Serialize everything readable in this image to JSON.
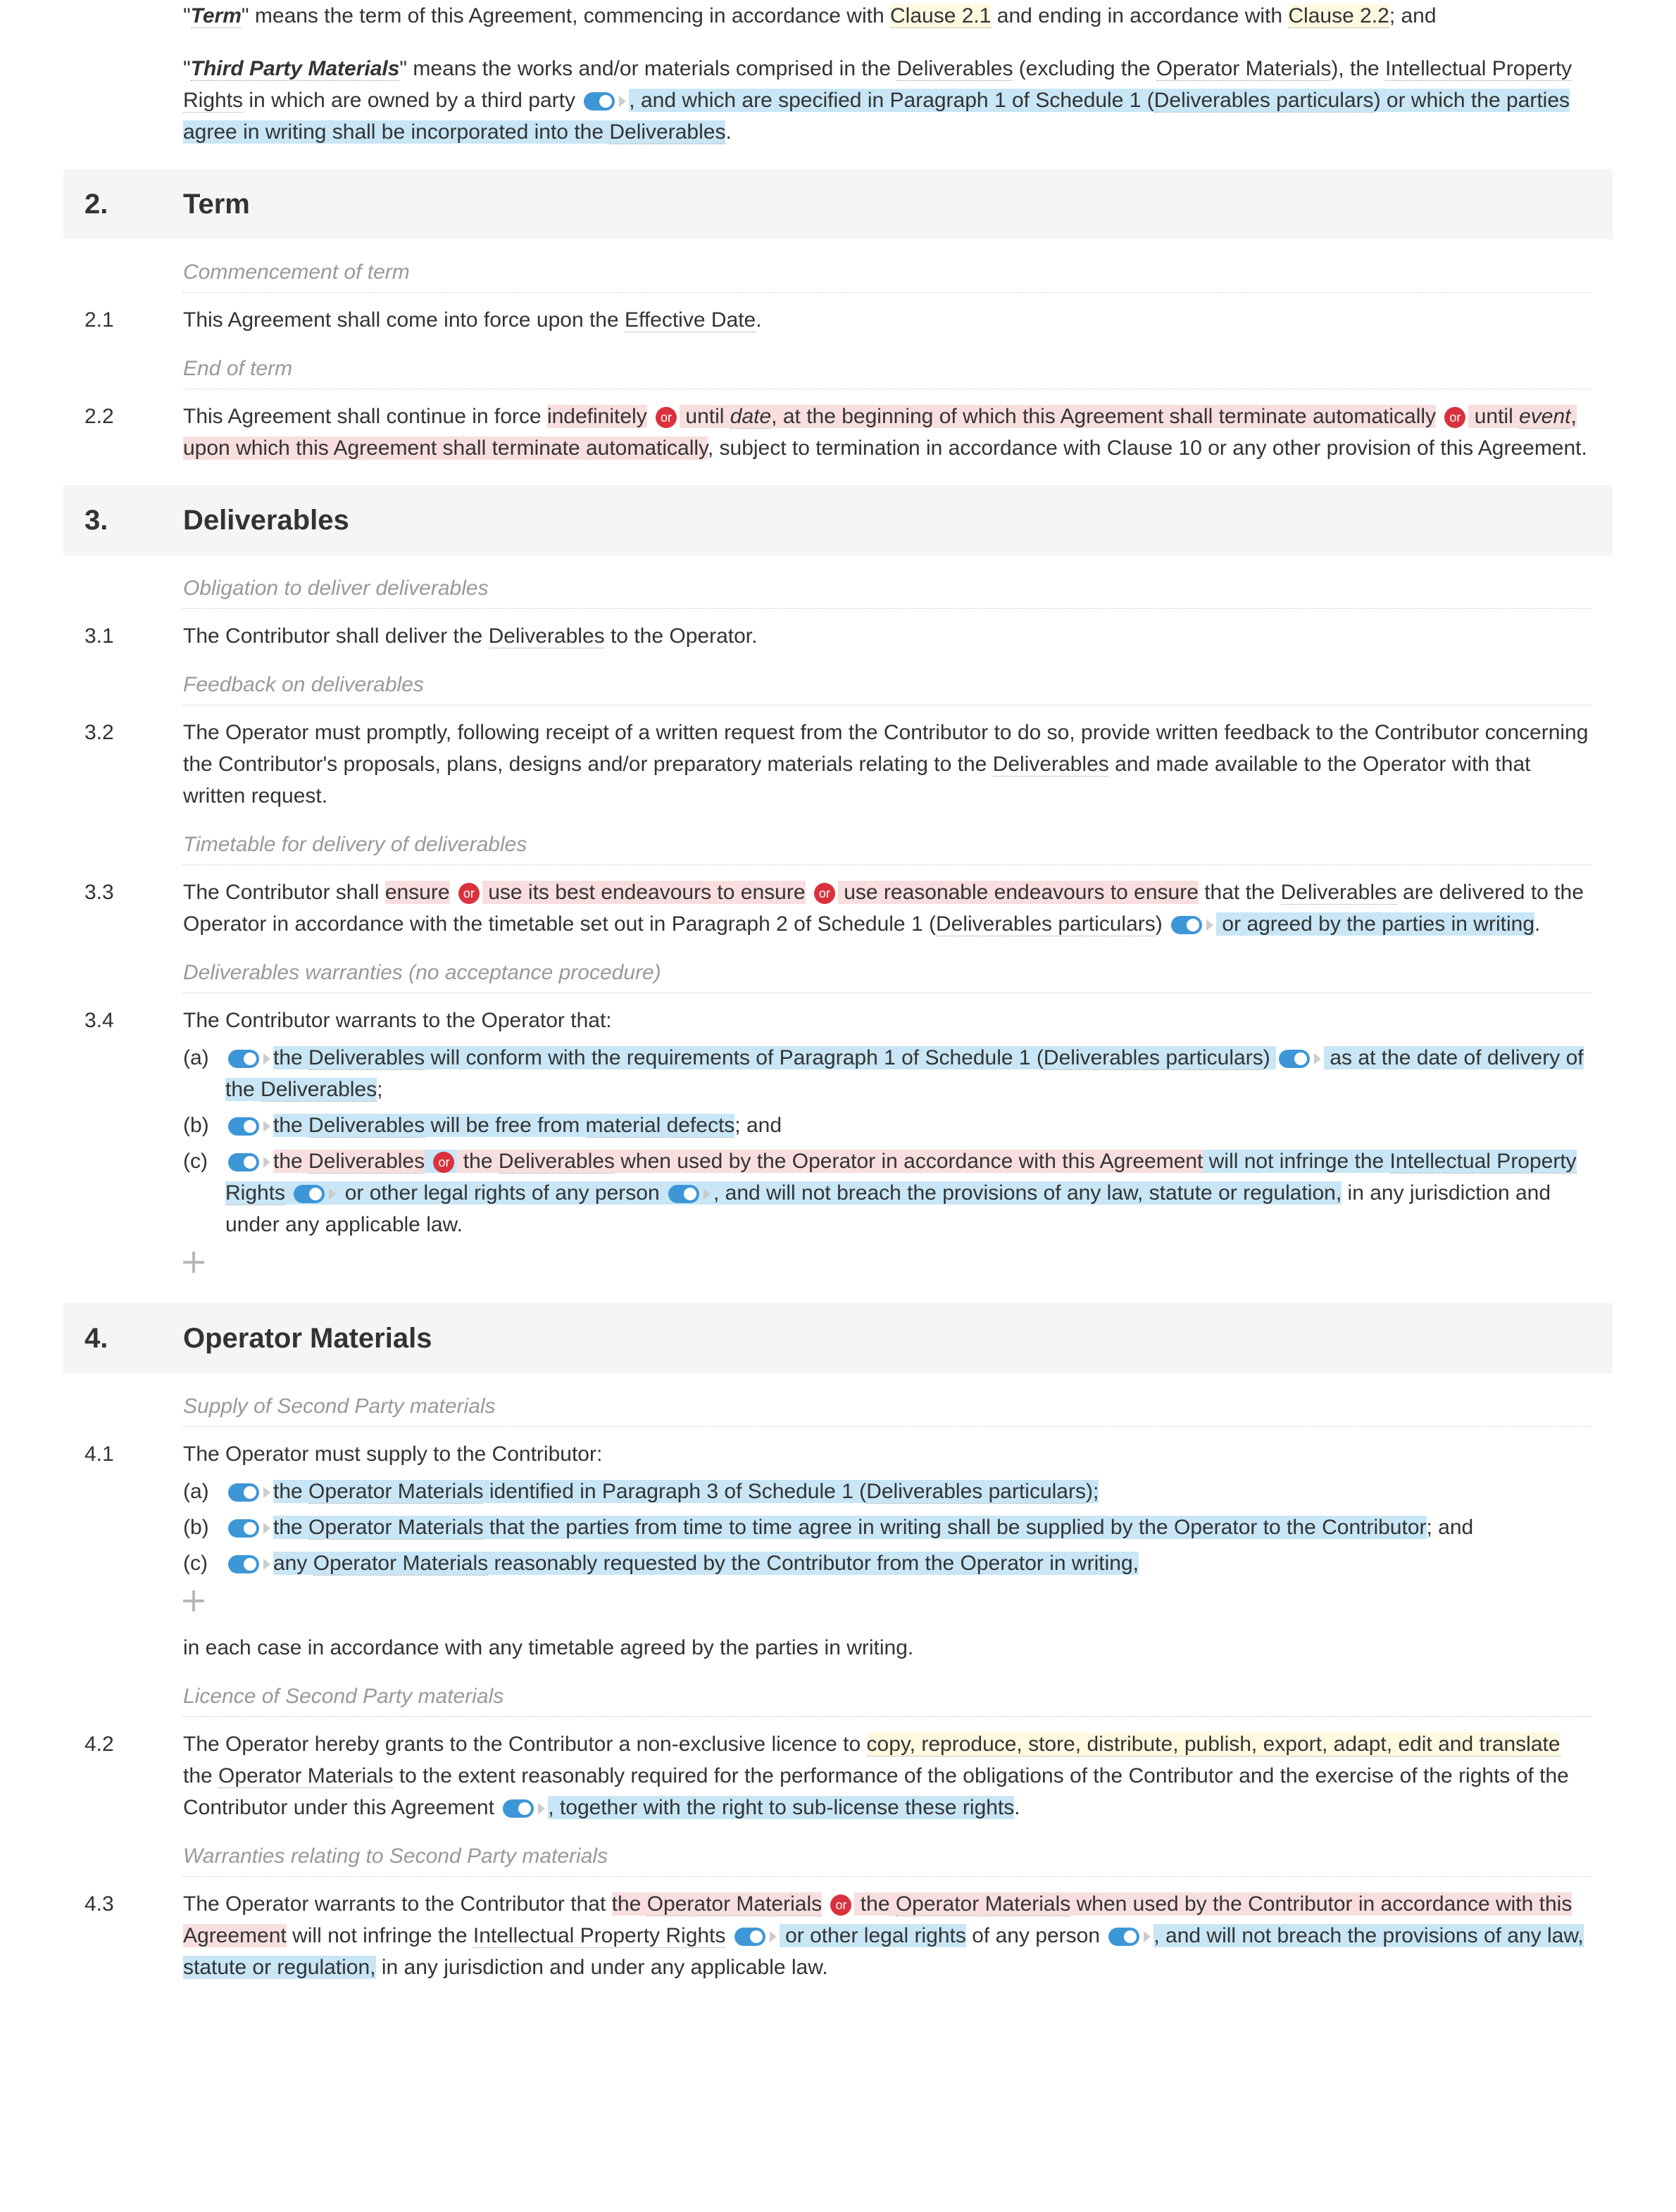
{
  "def_term": {
    "label": "Term",
    "t1": "\" means the term of this Agreement, commencing in accordance with ",
    "c21": "Clause 2.1",
    "t2": " and ending in accordance with ",
    "c22": "Clause 2.2",
    "t3": "; and"
  },
  "def_tpm": {
    "label": "Third Party Materials",
    "t1": "\" means the works and/or materials comprised in the ",
    "deliv": "Deliverables",
    "t2": " (excluding the ",
    "opmat": "Operator Materials",
    "t3": "), the ",
    "ipr": "Intellectual Property Rights",
    "t4": " in which are owned by a third party ",
    "t5": ", and which are specified in Paragraph 1 of Schedule 1 (",
    "dp": "Deliverables particulars",
    "t6": ") or which the parties agree in writing shall be incorporated into the ",
    "deliv2": "Deliverables",
    "t7": "."
  },
  "s2": {
    "num": "2.",
    "title": "Term"
  },
  "s2_1h": "Commencement of term",
  "c2_1": {
    "num": "2.1",
    "t1": "This Agreement shall come into force upon the ",
    "ed": "Effective Date",
    "t2": "."
  },
  "s2_2h": "End of term",
  "c2_2": {
    "num": "2.2",
    "t1": "This Agreement shall continue in force ",
    "indef": "indefinitely",
    "or": "or",
    "until": " until ",
    "date": "date",
    "t2": ", at the beginning of which this Agreement shall terminate automatically",
    "until2": " until ",
    "event": "event",
    "t3": ", upon which this Agreement shall terminate automatically",
    "t4": ", subject to termination in accordance with Clause 10 or any other provision of this Agreement."
  },
  "s3": {
    "num": "3.",
    "title": "Deliverables"
  },
  "s3_1h": "Obligation to deliver deliverables",
  "c3_1": {
    "num": "3.1",
    "t1": "The Contributor shall deliver the ",
    "d": "Deliverables",
    "t2": " to the Operator."
  },
  "s3_2h": "Feedback on deliverables",
  "c3_2": {
    "num": "3.2",
    "t1": "The Operator must promptly, following receipt of a written request from the Contributor to do so, provide written feedback to the Contributor concerning the Contributor's proposals, plans, designs and/or preparatory materials relating to the ",
    "d": "Deliverables",
    "t2": " and made available to the Operator with that written request."
  },
  "s3_3h": "Timetable for delivery of deliverables",
  "c3_3": {
    "num": "3.3",
    "t1": "The Contributor shall ",
    "ensure": "ensure",
    "or": "or",
    "best": " use its best endeavours to ensure",
    "reasonable": " use reasonable endeavours to ensure",
    "t2": " that the ",
    "d": "Deliverables",
    "t3": " are delivered to the Operator in accordance with the timetable set out in Paragraph 2 of Schedule 1 (",
    "dp": "Deliverables particulars",
    "t4": ") ",
    "agreed": " or agreed by the parties in writing",
    "t5": "."
  },
  "s3_4h": "Deliverables warranties (no acceptance procedure)",
  "c3_4": {
    "num": "3.4",
    "intro": "The Contributor warrants to the Operator that:",
    "a": {
      "letter": "(a)",
      "t1": "the ",
      "d": "Deliverables",
      "t2": " will conform with the requirements of Paragraph 1 of Schedule 1 (",
      "dp": "Deliverables particulars",
      "t3": ") ",
      "asat": " as at the date of delivery of the ",
      "d2": "Deliverables",
      "t4": ";"
    },
    "b": {
      "letter": "(b)",
      "t1": "the ",
      "d": "Deliverables",
      "t2": " will be free from ",
      "md": "material defects",
      "t3": "; and"
    },
    "c": {
      "letter": "(c)",
      "t1": "the ",
      "d": "Deliverables",
      "or": "or",
      "alt": " the ",
      "d2": "Deliverables",
      "alt2": " when used by the Operator in accordance with this Agreement",
      "t2": " will not infringe the ",
      "ipr": "Intellectual Property Rights",
      "olr": " or other legal rights",
      "t3": " of any person ",
      "law": ", and will not breach the provisions of any law, statute or regulation,",
      "t4": " in any jurisdiction and under any applicable law."
    }
  },
  "s4": {
    "num": "4.",
    "title": "Operator Materials"
  },
  "s4_1h": "Supply of Second Party materials",
  "c4_1": {
    "num": "4.1",
    "intro": "The Operator must supply to the Contributor:",
    "a": {
      "letter": "(a)",
      "t1": "the ",
      "om": "Operator Materials",
      "t2": " identified in Paragraph 3 of Schedule 1 (",
      "dp": "Deliverables particulars",
      "t3": ");"
    },
    "b": {
      "letter": "(b)",
      "t1": "the ",
      "om": "Operator Materials",
      "t2": " that the parties from time to time agree in writing shall be supplied by the Operator to the Contributor",
      "t3": "; and"
    },
    "c": {
      "letter": "(c)",
      "t1": "any ",
      "om": "Operator Materials",
      "t2": " reasonably requested by the Contributor from the Operator in writing,"
    },
    "tail": "in each case in accordance with any timetable agreed by the parties in writing."
  },
  "s4_2h": "Licence of Second Party materials",
  "c4_2": {
    "num": "4.2",
    "t1": "The Operator hereby grants to the Contributor a non-exclusive licence to ",
    "verbs": "copy, reproduce, store, distribute, publish, export, adapt, edit and translate",
    "t2": " the ",
    "om": "Operator Materials",
    "t3": " to the extent reasonably required for the performance of the obligations of the Contributor and the exercise of the rights of the Contributor under this Agreement ",
    "sub": ", together with the right to sub-license these rights",
    "t4": "."
  },
  "s4_3h": "Warranties relating to Second Party materials",
  "c4_3": {
    "num": "4.3",
    "t1": "The Operator warrants to the Contributor that ",
    "om1": "the ",
    "omref": "Operator Materials",
    "or": "or",
    "alt": " the ",
    "omref2": "Operator Materials",
    "alt2": " when used by the Contributor in accordance with this Agreement",
    "t2": " will not infringe the ",
    "ipr": "Intellectual Property Rights",
    "olr": " or other legal rights",
    "t3": " of any person ",
    "law": ", and will not breach the provisions of any law, statute or regulation,",
    "t4": " in any jurisdiction and under any applicable law."
  }
}
